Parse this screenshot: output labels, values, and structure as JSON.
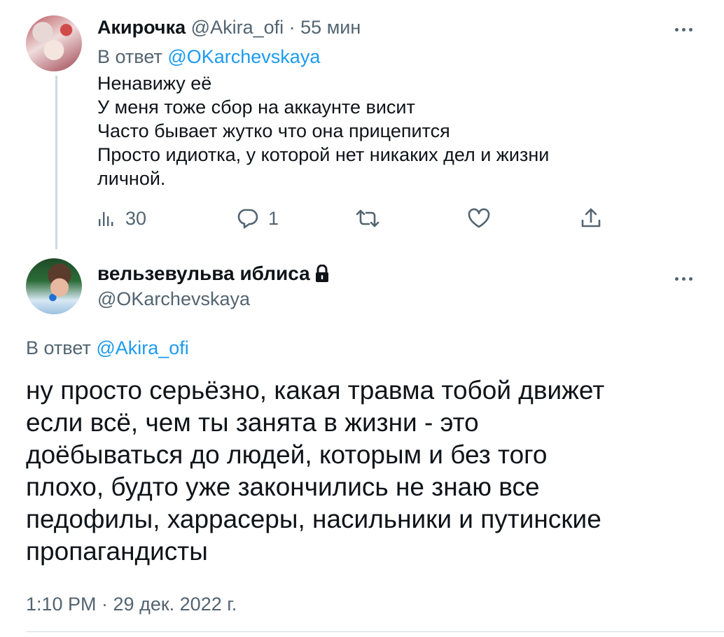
{
  "tweet1": {
    "display_name": "Акирочка",
    "handle": "@Akira_ofi",
    "separator": "·",
    "time": "55 мин",
    "reply_prefix": "В ответ",
    "reply_to": "@OKarchevskaya",
    "lines": [
      "Ненавижу её",
      "У меня тоже сбор на аккаунте висит",
      "Часто бывает жутко что она прицепится",
      "Просто идиотка, у которой нет никаких дел и жизни",
      "личной."
    ],
    "views": "30",
    "replies": "1",
    "icons": [
      "views-icon",
      "reply-icon",
      "retweet-icon",
      "like-icon",
      "share-icon",
      "more-icon"
    ]
  },
  "tweet2": {
    "display_name": "вельзевульва иблиса",
    "handle": "@OKarchevskaya",
    "protected_icon": "lock-icon",
    "reply_prefix": "В ответ",
    "reply_to": "@Akira_ofi",
    "lines": [
      "ну просто серьёзно, какая травма тобой движет",
      "если всё, чем ты занята в жизни - это",
      "доёбываться до людей, которым и без того",
      "плохо, будто уже закончились не знаю все",
      "педофилы, харрасеры, насильники и путинские",
      "пропагандисты"
    ],
    "timestamp": "1:10 PM · 29 дек. 2022 г."
  },
  "colors": {
    "text": "#0f1419",
    "muted": "#536471",
    "link": "#1d9bf0",
    "line": "#cfd9de"
  }
}
